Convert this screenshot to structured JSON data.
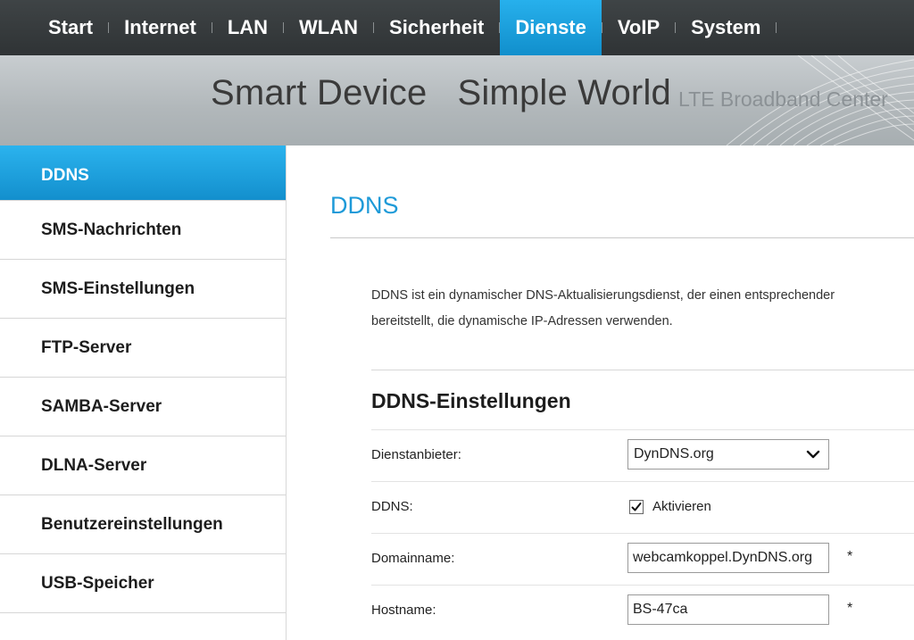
{
  "nav": {
    "items": [
      {
        "label": "Start"
      },
      {
        "label": "Internet"
      },
      {
        "label": "LAN"
      },
      {
        "label": "WLAN"
      },
      {
        "label": "Sicherheit"
      },
      {
        "label": "Dienste",
        "active": true
      },
      {
        "label": "VoIP"
      },
      {
        "label": "System"
      }
    ]
  },
  "banner": {
    "slogan_part1": "Smart Device",
    "slogan_part2": "Simple World",
    "subslogan": "LTE Broadband Center"
  },
  "sidebar": {
    "items": [
      {
        "label": "DDNS",
        "active": true
      },
      {
        "label": "SMS-Nachrichten"
      },
      {
        "label": "SMS-Einstellungen"
      },
      {
        "label": "FTP-Server"
      },
      {
        "label": "SAMBA-Server"
      },
      {
        "label": "DLNA-Server"
      },
      {
        "label": "Benutzereinstellungen"
      },
      {
        "label": "USB-Speicher"
      }
    ]
  },
  "main": {
    "title": "DDNS",
    "description_line1": "DDNS ist ein dynamischer DNS-Aktualisierungsdienst, der einen entsprechender",
    "description_line2": "bereitstellt, die dynamische IP-Adressen verwenden.",
    "section_title": "DDNS-Einstellungen",
    "fields": {
      "provider": {
        "label": "Dienstanbieter:",
        "value": "DynDNS.org"
      },
      "ddns": {
        "label": "DDNS:",
        "checkbox_label": "Aktivieren",
        "checked": true
      },
      "domain": {
        "label": "Domainname:",
        "value": "webcamkoppel.DynDNS.org",
        "required_mark": "*"
      },
      "hostname": {
        "label": "Hostname:",
        "value": "BS-47ca",
        "required_mark": "*"
      }
    }
  },
  "colors": {
    "accent": "#1e9ad8",
    "nav_background": "#3a3f41"
  }
}
